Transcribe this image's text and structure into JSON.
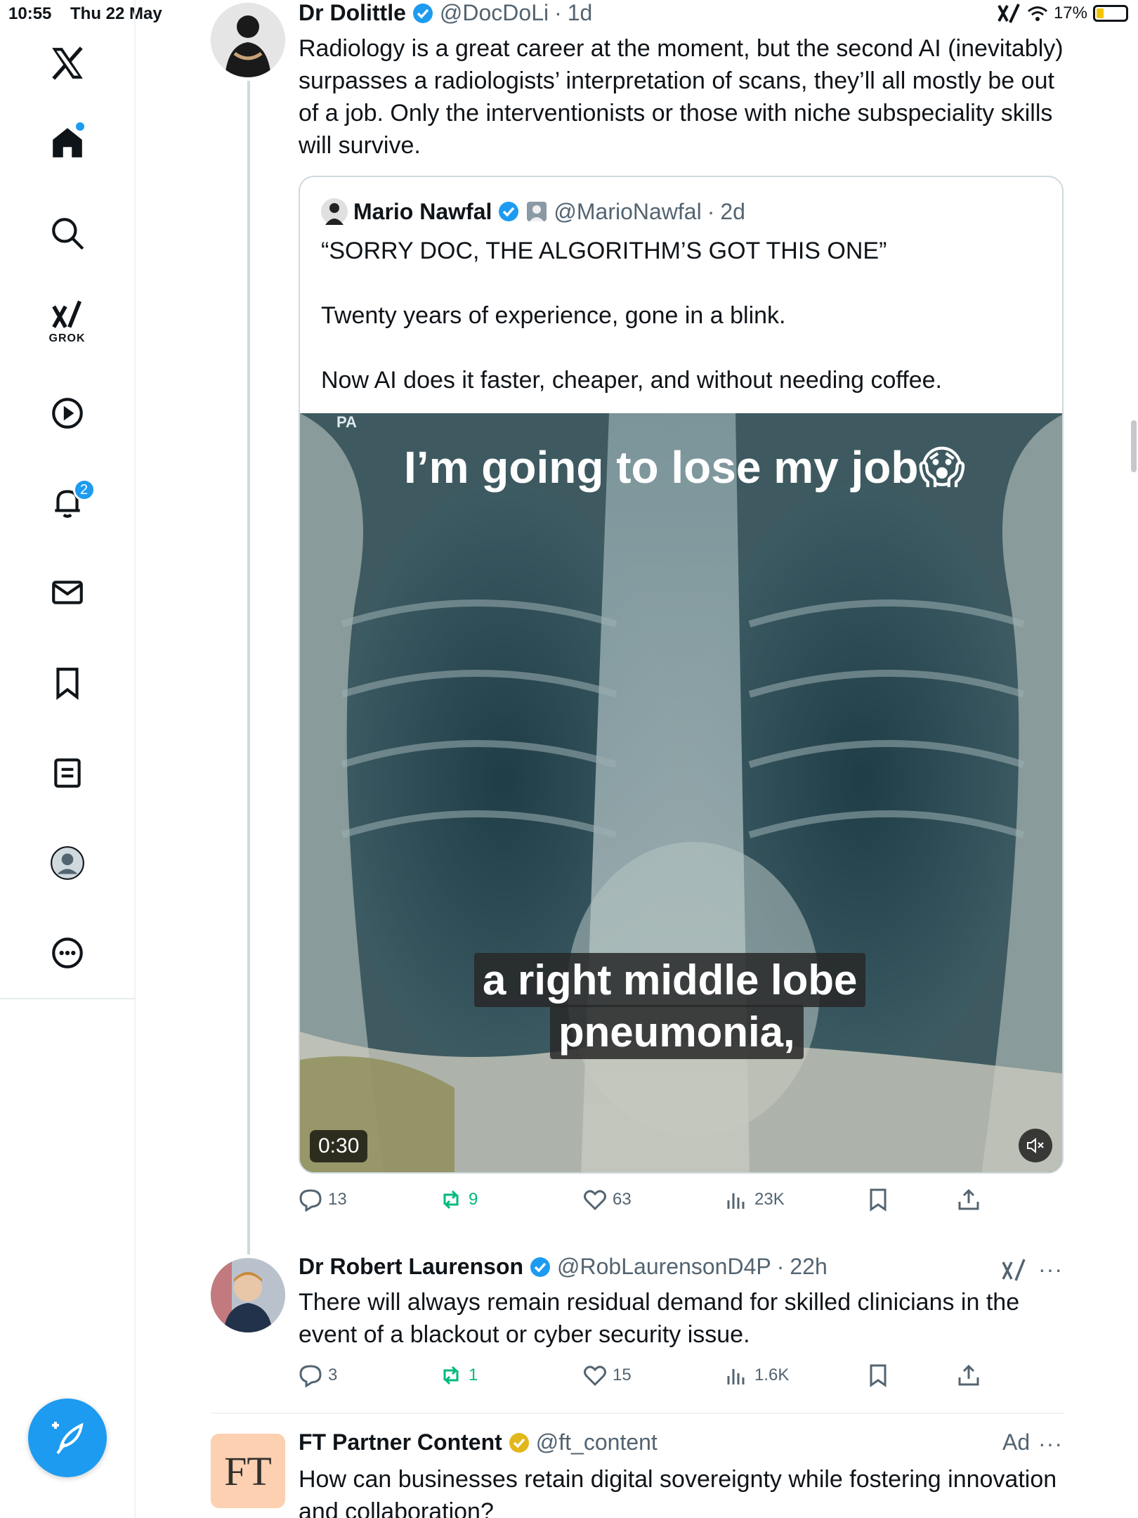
{
  "status": {
    "time": "10:55",
    "date": "Thu 22 May",
    "battery": "17%"
  },
  "sidebar": {
    "items": [
      {
        "name": "x-logo"
      },
      {
        "name": "home"
      },
      {
        "name": "search"
      },
      {
        "name": "grok",
        "label": "GROK"
      },
      {
        "name": "video"
      },
      {
        "name": "notifications",
        "badge": "2"
      },
      {
        "name": "messages"
      },
      {
        "name": "bookmarks"
      },
      {
        "name": "lists"
      },
      {
        "name": "profile"
      },
      {
        "name": "more"
      }
    ]
  },
  "main_post": {
    "name": "Dr Dolittle",
    "handle": "@DocDoLi",
    "time": "1d",
    "text": "Radiology is a great career at the moment, but the second AI (inevitably) surpasses a radiologists’ interpretation of scans, they’ll all mostly be out of a job. Only the interventionists or those with niche subspeciality skills will survive.",
    "quote": {
      "name": "Mario Nawfal",
      "handle": "@MarioNawfal",
      "time": "2d",
      "line1": "“SORRY DOC, THE ALGORITHM’S GOT THIS ONE”",
      "line2": "Twenty years of experience, gone in a blink.",
      "line3": "Now AI does it faster, cheaper, and without needing coffee.",
      "video": {
        "top_caption": "I’m going to lose my job😱",
        "subtitle_line1": "a right middle lobe",
        "subtitle_line2": "pneumonia,",
        "pa_label": "PA",
        "duration": "0:30"
      }
    },
    "stats": {
      "replies": "13",
      "reposts": "9",
      "likes": "63",
      "views": "23K"
    }
  },
  "reply_post": {
    "name": "Dr Robert Laurenson",
    "handle": "@RobLaurensonD4P",
    "time": "22h",
    "text": "There will always remain residual demand for skilled clinicians in the event of a blackout or cyber security issue.",
    "stats": {
      "replies": "3",
      "reposts": "1",
      "likes": "15",
      "views": "1.6K"
    }
  },
  "ad_post": {
    "logo_text": "FT",
    "name": "FT Partner Content",
    "handle": "@ft_content",
    "ad_label": "Ad",
    "text": "How can businesses retain digital sovereignty while fostering innovation and collaboration?"
  },
  "colors": {
    "accent": "#1d9bf0",
    "repost": "#00ba7c",
    "secondary_text": "#536471",
    "border": "#cfd9de"
  }
}
